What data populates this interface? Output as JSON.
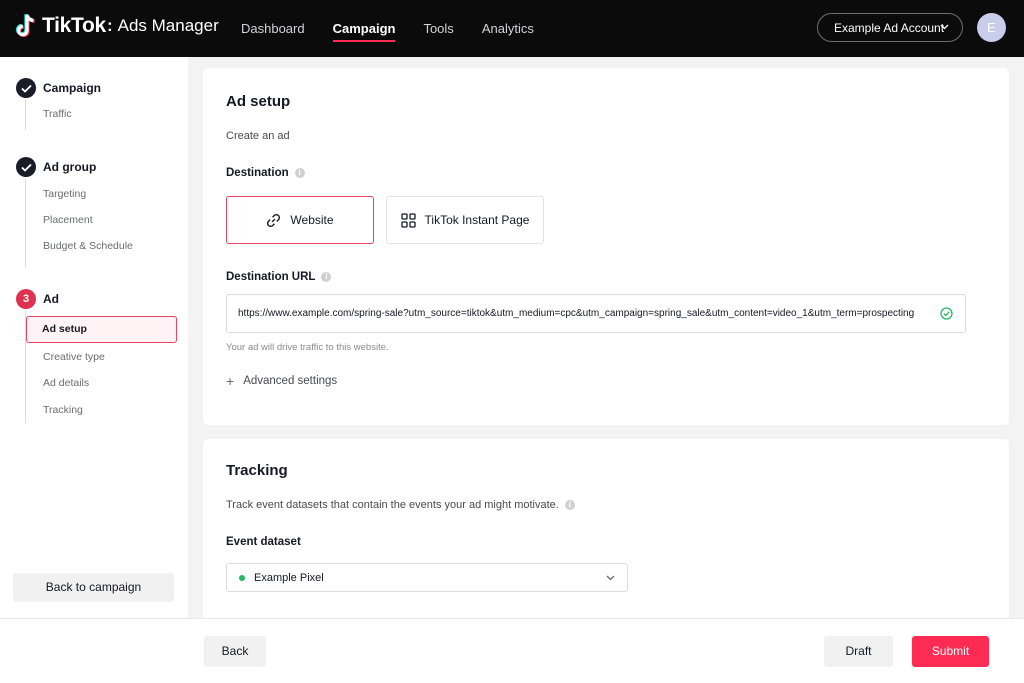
{
  "header": {
    "brand": "TikTok",
    "separator": ":",
    "product": "Ads Manager",
    "nav": [
      "Dashboard",
      "Campaign",
      "Tools",
      "Analytics"
    ],
    "active_nav": "Campaign",
    "account_label": "Example Ad Account",
    "avatar_initial": "E",
    "accent_color": "#fe2c55"
  },
  "sidebar": {
    "steps": [
      {
        "label": "Campaign",
        "status": "complete",
        "substeps": [
          "Traffic"
        ]
      },
      {
        "label": "Ad group",
        "status": "complete",
        "substeps": [
          "Targeting",
          "Placement",
          "Budget & Schedule"
        ]
      },
      {
        "label": "Ad",
        "status": "current",
        "number": "3",
        "active_substep": "Ad setup",
        "substeps": [
          "Ad setup",
          "Creative type",
          "Ad details",
          "Tracking"
        ]
      }
    ],
    "back_label": "Back to campaign"
  },
  "ad_setup": {
    "title": "Ad setup",
    "subtitle": "Create an ad",
    "destination_label": "Destination",
    "destination_options": [
      "Website",
      "TikTok Instant Page"
    ],
    "selected_destination": "Website",
    "url_label": "Destination URL",
    "url_value": "https://www.example.com/spring-sale?utm_source=tiktok&utm_medium=cpc&utm_campaign=spring_sale&utm_content=video_1&utm_term=prospecting",
    "url_hint": "Your ad will drive traffic to this website.",
    "advanced_label": "Advanced settings"
  },
  "tracking": {
    "title": "Tracking",
    "description": "Track event datasets that contain the events your ad might motivate.",
    "dataset_label": "Event dataset",
    "dataset_value": "Example Pixel"
  },
  "footer": {
    "back_label": "Back",
    "draft_label": "Draft",
    "submit_label": "Submit"
  }
}
